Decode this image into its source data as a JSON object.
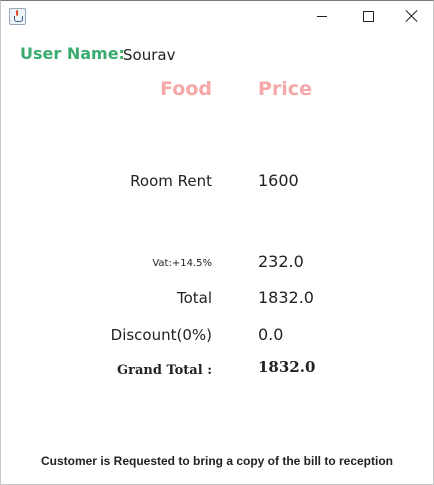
{
  "window": {
    "app_icon": "java-cup-icon",
    "controls": {
      "minimize": "minimize-icon",
      "maximize": "maximize-icon",
      "close": "close-icon"
    }
  },
  "user": {
    "label": "User Name:",
    "value": "Sourav"
  },
  "columns": {
    "food": "Food",
    "price": "Price"
  },
  "colors": {
    "user_label": "#3aad6e",
    "column_header": "#f6a8a8"
  },
  "bill": {
    "room_label": "Room Rent",
    "room_value": "1600",
    "vat_label": "Vat:+14.5%",
    "vat_value": "232.0",
    "total_label": "Total",
    "total_value": "1832.0",
    "discount_label": "Discount(0%)",
    "discount_value": "0.0",
    "grand_label": "Grand Total :",
    "grand_value": "1832.0"
  },
  "footer": {
    "note": "Customer is Requested to bring a copy of the bill to reception"
  }
}
